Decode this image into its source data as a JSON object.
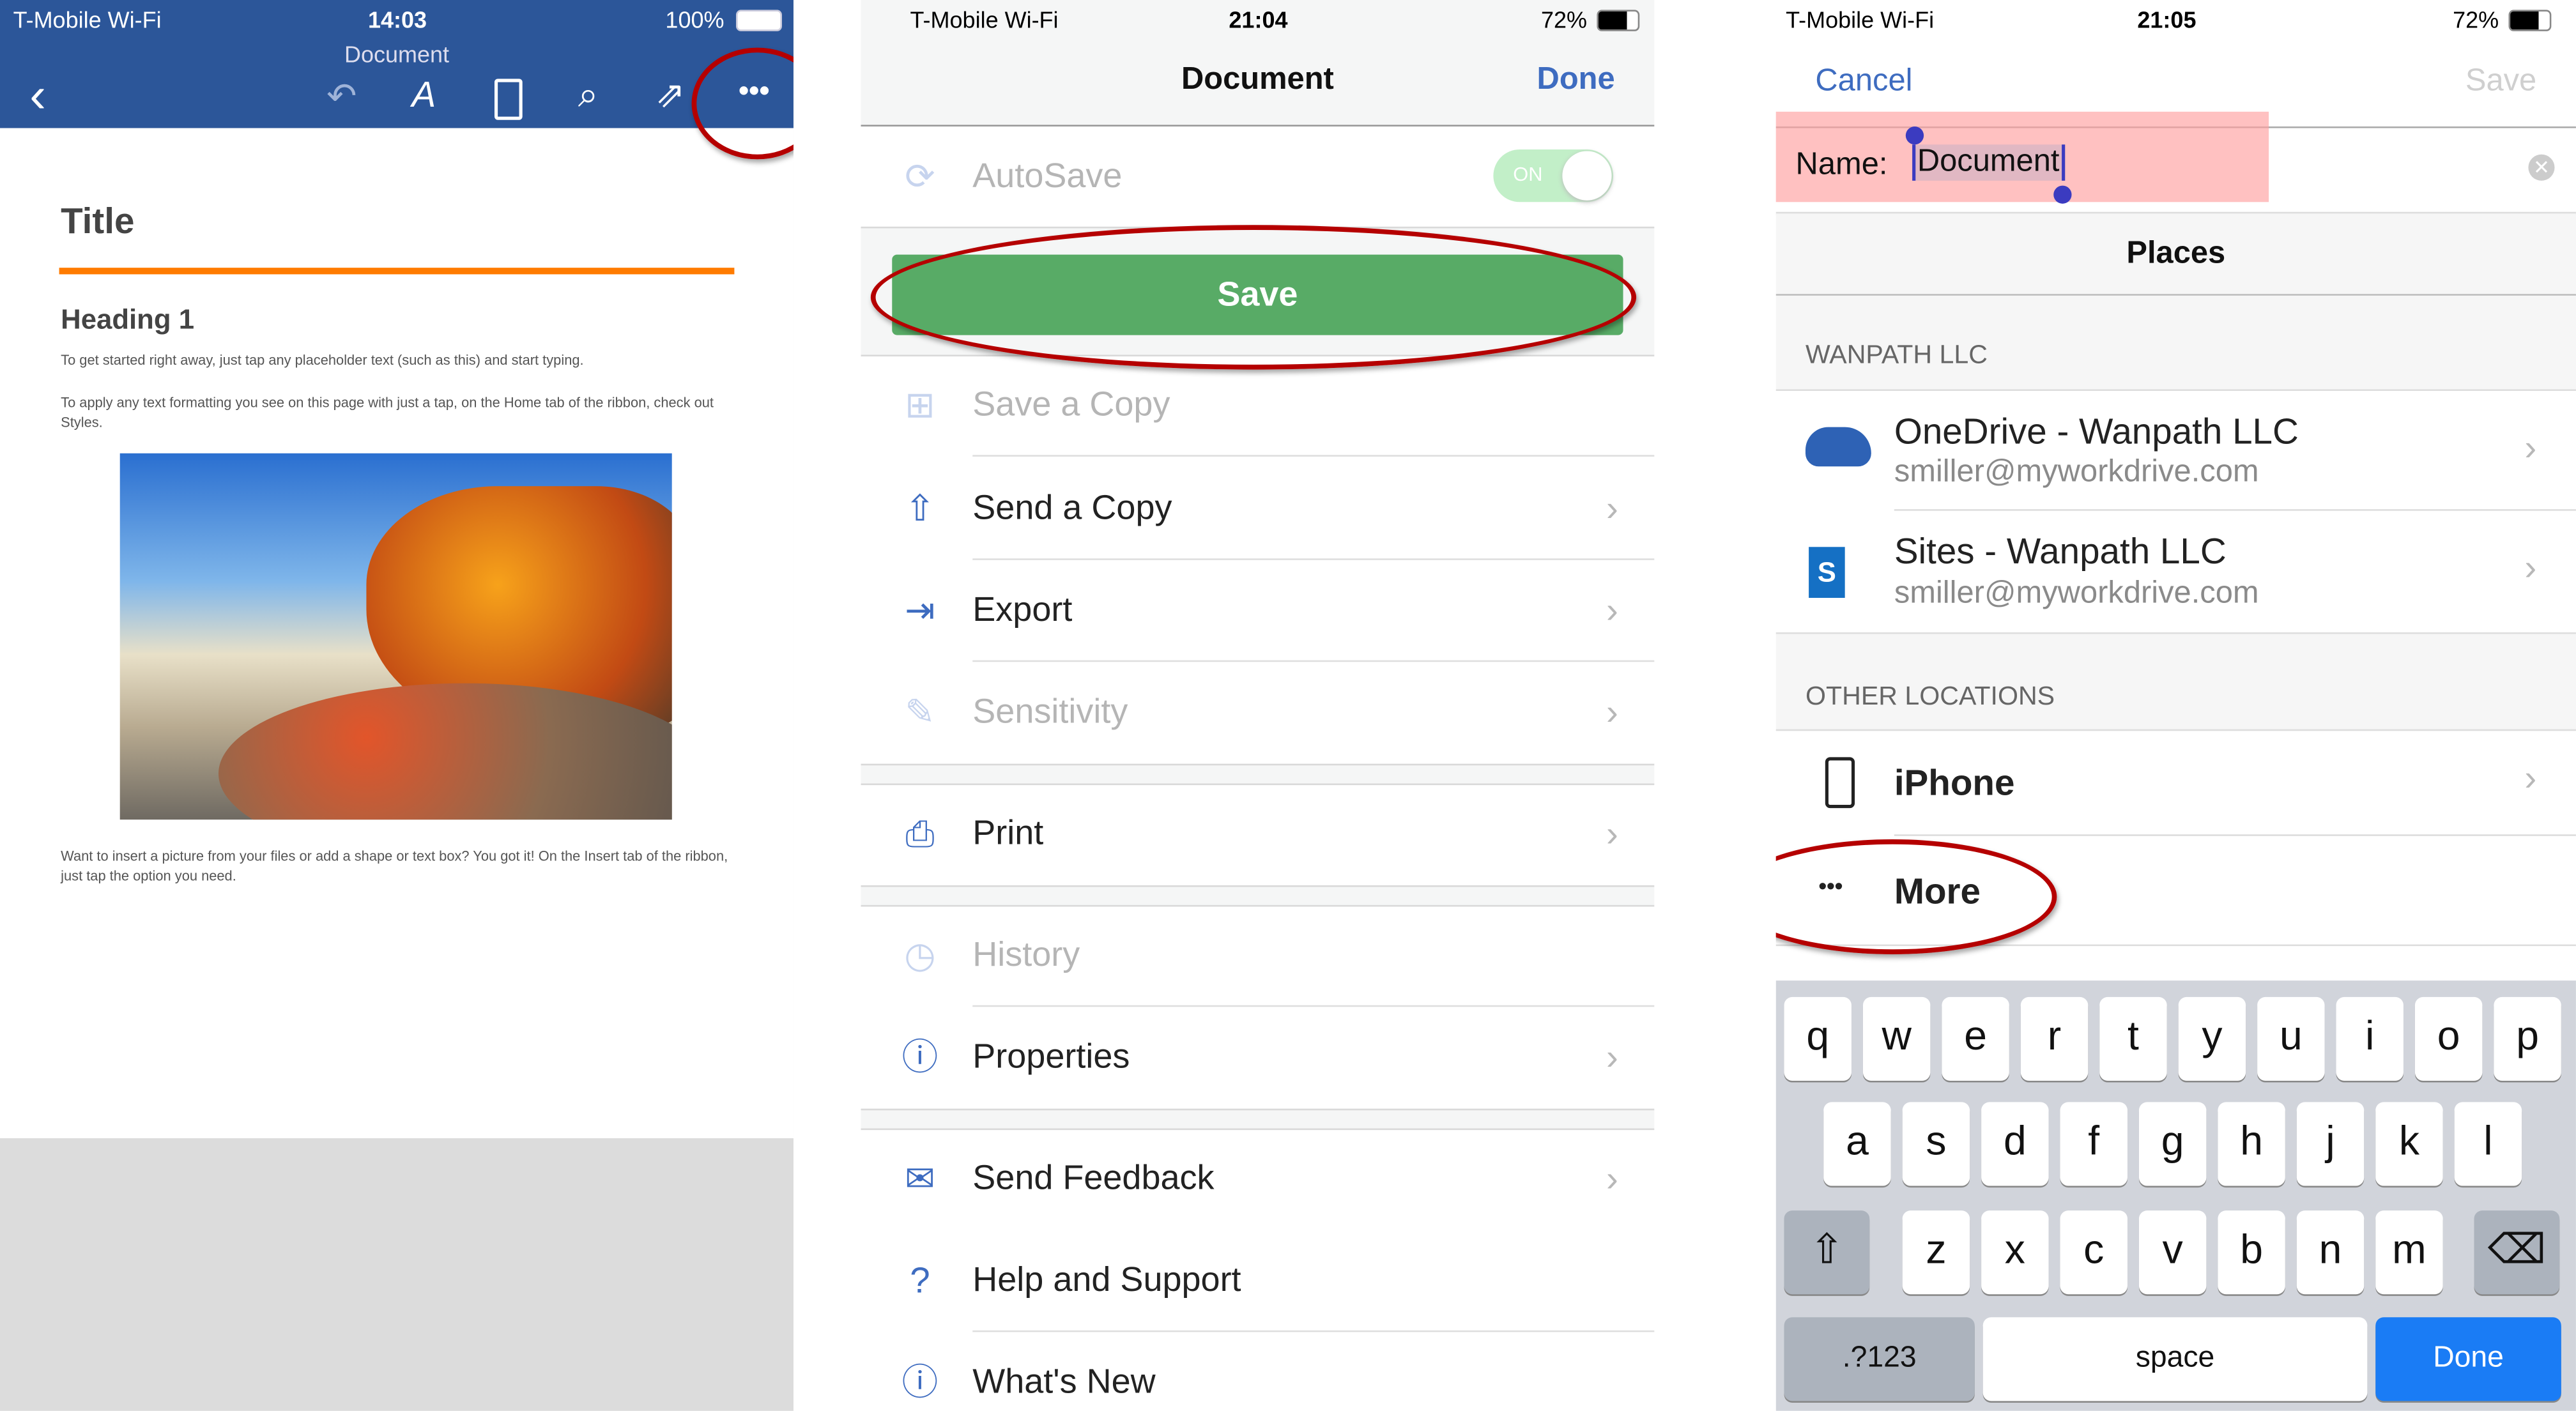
{
  "panel1": {
    "status": {
      "carrier": "T-Mobile Wi-Fi",
      "time": "14:03",
      "battery": "100%"
    },
    "doc_name": "Document",
    "toolbar_icons": [
      "back-chevron-icon",
      "undo-icon",
      "draw-pen-icon",
      "mobile-view-icon",
      "search-icon",
      "share-icon",
      "more-ellipsis-icon"
    ],
    "more_label": "•••",
    "doc": {
      "title": "Title",
      "heading": "Heading 1",
      "para1": "To get started right away, just tap any placeholder text (such as this) and start typing.",
      "para2": "To apply any text formatting you see on this page with just a tap, on the Home tab of the ribbon, check out Styles.",
      "para3": "Want to insert a picture from your files or add a shape or text box? You got it! On the Insert tab of the ribbon, just tap the option you need."
    },
    "colors": {
      "bar": "#2c5699",
      "accent_line": "#ff7b00"
    }
  },
  "panel2": {
    "status": {
      "carrier": "T-Mobile Wi-Fi",
      "time": "21:04",
      "battery": "72%"
    },
    "header": {
      "title": "Document",
      "done": "Done"
    },
    "autosave": {
      "label": "AutoSave",
      "toggle": "ON"
    },
    "save_button": "Save",
    "items": [
      {
        "label": "Save a Copy",
        "icon": "save-copy-icon"
      },
      {
        "label": "Send a Copy",
        "icon": "share-icon"
      },
      {
        "label": "Export",
        "icon": "export-icon"
      },
      {
        "label": "Sensitivity",
        "icon": "sensitivity-icon"
      },
      {
        "label": "Print",
        "icon": "print-icon"
      },
      {
        "label": "History",
        "icon": "history-icon"
      },
      {
        "label": "Properties",
        "icon": "info-icon"
      },
      {
        "label": "Send Feedback",
        "icon": "feedback-icon"
      },
      {
        "label": "Help and Support",
        "icon": "help-icon"
      },
      {
        "label": "What's New",
        "icon": "info-icon"
      }
    ],
    "colors": {
      "save": "#58ab66",
      "link": "#3e6cc0"
    }
  },
  "panel3": {
    "status": {
      "carrier": "T-Mobile Wi-Fi",
      "time": "21:05",
      "battery": "72%"
    },
    "cancel": "Cancel",
    "save": "Save",
    "name_label": "Name:",
    "name_value": "Document",
    "places": "Places",
    "section1": "WANPATH LLC",
    "onedrive": {
      "title": "OneDrive - Wanpath LLC",
      "sub": "smiller@myworkdrive.com"
    },
    "sites": {
      "title": "Sites - Wanpath LLC",
      "sub": "smiller@myworkdrive.com"
    },
    "section2": "OTHER LOCATIONS",
    "iphone": "iPhone",
    "more": "More",
    "more_icon": "•••",
    "keyboard": {
      "row1": [
        "q",
        "w",
        "e",
        "r",
        "t",
        "y",
        "u",
        "i",
        "o",
        "p"
      ],
      "row2": [
        "a",
        "s",
        "d",
        "f",
        "g",
        "h",
        "j",
        "k",
        "l"
      ],
      "row3": [
        "z",
        "x",
        "c",
        "v",
        "b",
        "n",
        "m"
      ],
      "numbers": ".?123",
      "space": "space",
      "done": "Done"
    }
  }
}
